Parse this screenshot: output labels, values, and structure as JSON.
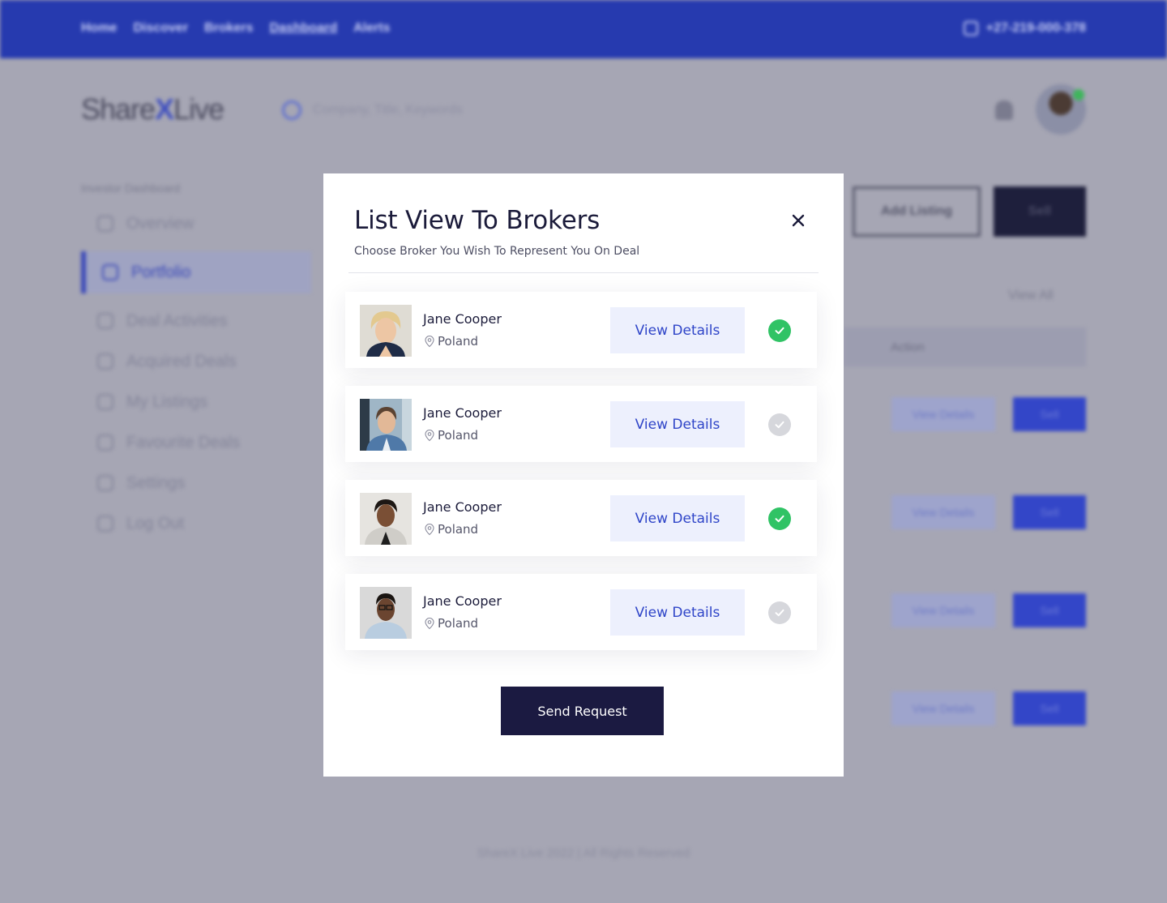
{
  "top_nav": {
    "items": [
      "Home",
      "Discover",
      "Brokers",
      "Dashboard",
      "Alerts"
    ],
    "active": "Dashboard",
    "phone": "+27-219-000-378"
  },
  "header": {
    "logo_pre": "Share",
    "logo_x": "X",
    "logo_post": "Live",
    "search_placeholder": "Company, Title, Keywords"
  },
  "sidebar": {
    "section_label": "Investor Dashboard",
    "items": [
      {
        "label": "Overview",
        "icon": "grid-icon"
      },
      {
        "label": "Portfolio",
        "icon": "pie-chart-icon",
        "active": true
      },
      {
        "label": "Deal Activities",
        "icon": "activity-icon"
      },
      {
        "label": "Acquired Deals",
        "icon": "briefcase-icon"
      },
      {
        "label": "My Listings",
        "icon": "list-icon"
      },
      {
        "label": "Favourite Deals",
        "icon": "heart-icon"
      },
      {
        "label": "Settings",
        "icon": "gear-icon"
      },
      {
        "label": "Log Out",
        "icon": "logout-icon"
      }
    ]
  },
  "actions": {
    "add_listing": "Add Listing",
    "sell": "Sell",
    "view_all": "View All",
    "table_header_action": "Action",
    "row_view_details": "View Details",
    "row_sell": "Sell"
  },
  "footer": {
    "text": "ShareX Live 2022 | All Rights Reserved"
  },
  "modal": {
    "title": "List View To Brokers",
    "subtitle": "Choose Broker You Wish To Represent You On Deal",
    "brokers": [
      {
        "name": "Jane Cooper",
        "location": "Poland",
        "button": "View Details",
        "selected": true
      },
      {
        "name": "Jane Cooper",
        "location": "Poland",
        "button": "View Details",
        "selected": false
      },
      {
        "name": "Jane Cooper",
        "location": "Poland",
        "button": "View Details",
        "selected": true
      },
      {
        "name": "Jane Cooper",
        "location": "Poland",
        "button": "View Details",
        "selected": false
      }
    ],
    "send_button": "Send Request"
  },
  "colors": {
    "brand_blue": "#263aaf",
    "accent_blue": "#2f45c8",
    "dark_navy": "#1b1a41",
    "selected_green": "#30c365",
    "unselected_grey": "#d6d7dc",
    "overlay": "#a6a6b4"
  }
}
